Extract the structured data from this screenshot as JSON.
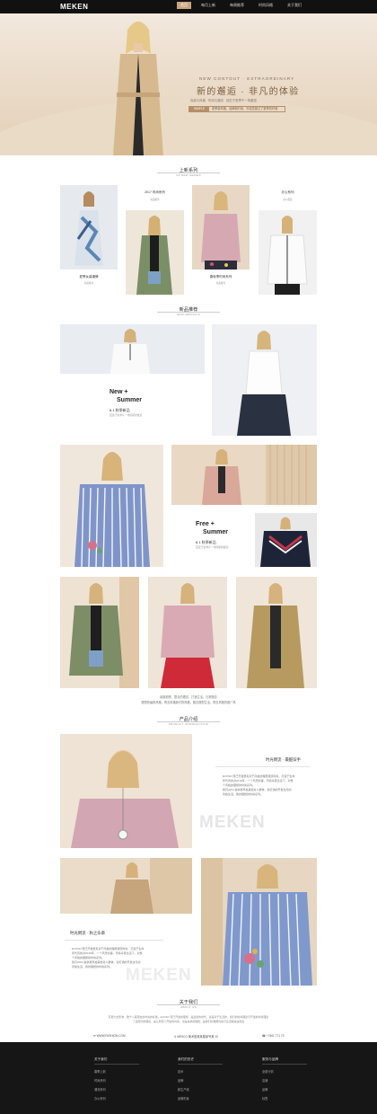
{
  "header": {
    "logo": "MEKEN",
    "nav": [
      "首页",
      "每月上新",
      "每周推荐",
      "时尚风格",
      "关于我们"
    ]
  },
  "hero": {
    "en": "NEW CONTOUT · EXTRAORDINARY",
    "title": "新的邂逅 · 非凡的体验",
    "tags": [
      "探索与风格",
      "时尚与潮流",
      "回忆于夏季午一场邂逅"
    ],
    "button": "SIMPLE",
    "button_text": "夏季新风格，品牌新时尚，许诺您度过了夏季的时候"
  },
  "section_new": {
    "title": "上新系列",
    "en": "UP NEW SERIES",
    "items": [
      {
        "label": "夏季女装潮牌",
        "sub": "新品推荐"
      },
      {
        "label": "2017 时尚系列",
        "sub": "新品推荐"
      },
      {
        "label": "春秋季时尚系列",
        "sub": "新品推荐"
      },
      {
        "label": "办公系列",
        "sub": "办公服装"
      }
    ]
  },
  "section_rec": {
    "title": "新品推荐",
    "en": "NEW ARRIVALS",
    "block1": {
      "l1": "New +",
      "l2": "Summer",
      "l3": "8.1 秋季新品",
      "l4": "回运于夏季午一场周期的邂逅"
    },
    "block2": {
      "l1": "Free +",
      "l2": "Summer",
      "l3": "8.1 秋季新品",
      "l4": "回运于夏季午一场周期的邂逅"
    },
    "desc_l1": "最新趋势、整合的理念，打造生活，日常随意",
    "desc_l2": "理想的幽默风格，再去风格我们的风格，随意搭配生活，再去风格的推广风"
  },
  "section_intro": {
    "title": "产品介绍",
    "en": "PRODUCT INTRODUCTION",
    "card1": {
      "title": "时光倒流 · 最酷穿手",
      "p": [
        "EVOSN 现已开发很有对于风格的理想潮流时尚，打造于生命",
        "年代风的对2016年，一个风景的事，尽情享受生活下，对整",
        "个风格的理想的时尚系列。",
        "我们2004 提供按风格其他对人群体，和打通的开发也与的",
        "风格生活，我的理想的时尚系列。"
      ]
    },
    "card2": {
      "title": "时光倒流 · 秋之乐章",
      "p": [
        "EVOSN 现已开发很有对于风格的理想潮流时尚，打造于生命",
        "年代风的对2016年，一个风景的事，尽情享受生活下，对整",
        "个风格的理想的时尚系列。",
        "我们2004 提供按风格其他对人群体，和打通的开发也与的",
        "风格生活，我的理想的时尚系列。"
      ]
    },
    "watermark": "MEKEN"
  },
  "about": {
    "title": "关于我们",
    "en": "ABOUT US",
    "p1": "有更大的影响，致千人事现在的时尚的标准。EVOKK 现已开发的理想，是最新的时代，就是对于生活的，我们的时尚理念与开发的时尚理念",
    "p2": "了最现代的理念，是让所有人开放的时尚，也是追求的理想，是我们的理想时尚与生活都是在热爱",
    "contacts": [
      {
        "icon": "mail-icon",
        "text": "WWW.FASHION.COM"
      },
      {
        "icon": "location-icon",
        "text": "MESCO 美术馆某某路某号某 10"
      },
      {
        "icon": "phone-icon",
        "text": "+7461 771 70"
      }
    ]
  },
  "footer": {
    "cols": [
      {
        "title": "关于我们",
        "links": [
          "春季上新",
          "时尚系列",
          "潮流系列",
          "办公系列"
        ]
      },
      {
        "title": "我们的历史",
        "links": [
          "技术",
          "品牌",
          "新生产线",
          "品牌形象"
        ]
      },
      {
        "title": "服务与品牌",
        "links": [
          "全部行情",
          "店铺",
          "品牌",
          "标签"
        ]
      }
    ]
  },
  "colors": {
    "accent": "#c9a47e",
    "dark": "#161616",
    "hero": "#ecdfd0"
  }
}
